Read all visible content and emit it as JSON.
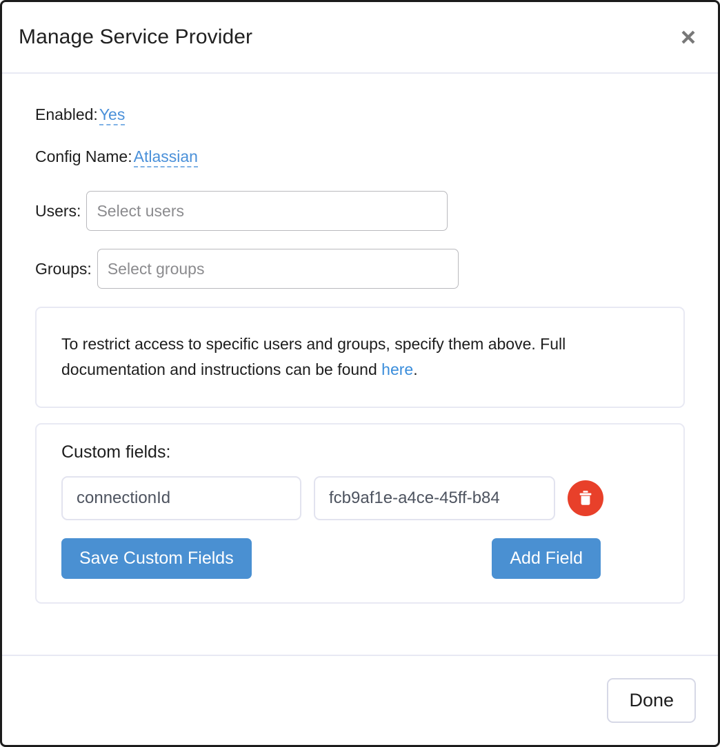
{
  "dialog": {
    "title": "Manage Service Provider",
    "close_icon": "close-icon"
  },
  "form": {
    "enabled": {
      "label": "Enabled:",
      "value": "Yes"
    },
    "config_name": {
      "label": "Config Name:",
      "value": "Atlassian"
    },
    "users": {
      "label": "Users:",
      "placeholder": "Select users",
      "value": ""
    },
    "groups": {
      "label": "Groups:",
      "placeholder": "Select groups",
      "value": ""
    }
  },
  "info_panel": {
    "text_before": "To restrict access to specific users and groups, specify them above. Full documentation and instructions can be found ",
    "link_text": "here",
    "text_after": "."
  },
  "custom_fields": {
    "title": "Custom fields:",
    "rows": [
      {
        "key": "connectionId",
        "value": "fcb9af1e-a4ce-45ff-b84",
        "delete_icon": "trash-icon"
      }
    ],
    "save_label": "Save Custom Fields",
    "add_label": "Add Field"
  },
  "footer": {
    "done_label": "Done"
  },
  "colors": {
    "primary_button": "#4a90d2",
    "link": "#3a8ddb",
    "editable_value": "#4a90d9",
    "delete_button": "#e8402a",
    "panel_border": "#e8e9f3"
  }
}
